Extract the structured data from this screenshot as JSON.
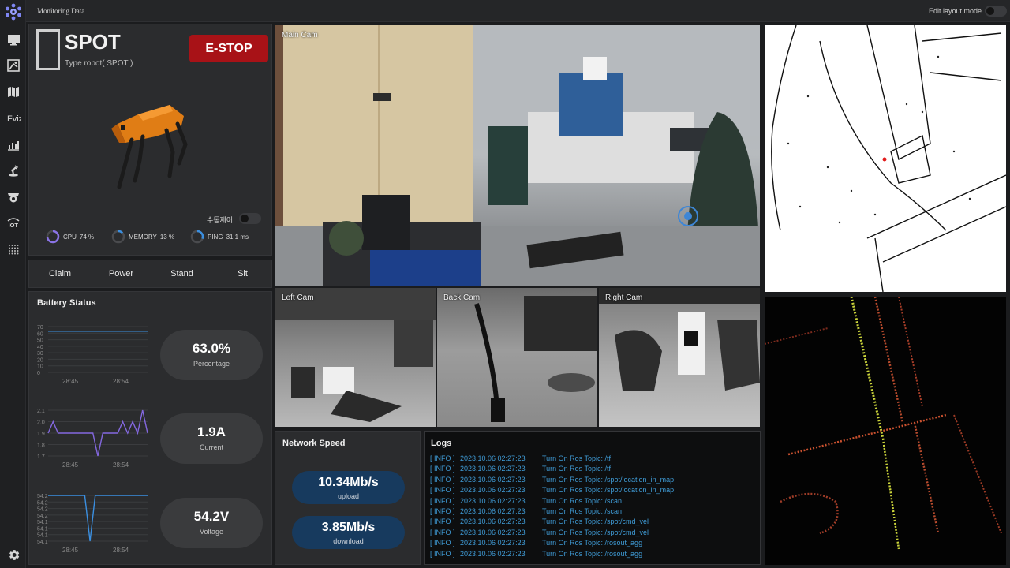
{
  "app": {
    "title": "Monitoring Data",
    "edit_layout_label": "Edit layout mode"
  },
  "sidebar": {
    "items": [
      {
        "icon": "monitor-icon"
      },
      {
        "icon": "map-edit-icon"
      },
      {
        "icon": "map-icon"
      },
      {
        "icon": "fviz-icon",
        "label": "Fviz"
      },
      {
        "icon": "chart-icon"
      },
      {
        "icon": "robot-arm-icon"
      },
      {
        "icon": "cctv-icon"
      },
      {
        "icon": "iot-icon",
        "label": "IOT"
      },
      {
        "icon": "grid-icon"
      }
    ],
    "settings_icon": "gear-icon"
  },
  "robot": {
    "name": "SPOT",
    "type": "Type robot( SPOT )",
    "estop_label": "E-STOP",
    "manual_label": "수동제어",
    "metrics": [
      {
        "label": "CPU",
        "value": "74 %",
        "fraction": 0.74
      },
      {
        "label": "MEMORY",
        "value": "13 %",
        "fraction": 0.13
      },
      {
        "label": "PING",
        "value": "31.1 ms",
        "fraction": 0.31
      }
    ]
  },
  "commands": [
    "Claim",
    "Power",
    "Stand",
    "Sit"
  ],
  "battery": {
    "title": "Battery Status",
    "percentage": {
      "value": "63.0%",
      "label": "Percentage"
    },
    "current": {
      "value": "1.9A",
      "label": "Current"
    },
    "voltage": {
      "value": "54.2V",
      "label": "Voltage"
    }
  },
  "chart_data": [
    {
      "type": "line",
      "x_ticks": [
        "28:45",
        "28:54"
      ],
      "y_ticks": [
        "70",
        "60",
        "50",
        "40",
        "30",
        "20",
        "10",
        "0"
      ],
      "ylim": [
        0,
        70
      ],
      "values": [
        63,
        63,
        63,
        63,
        63,
        63,
        63,
        63,
        63,
        63,
        63,
        63,
        63,
        63,
        63,
        63,
        63,
        63,
        63,
        63
      ],
      "color": "#3b8fe0"
    },
    {
      "type": "line",
      "x_ticks": [
        "28:45",
        "28:54"
      ],
      "y_ticks": [
        "2.1",
        "2.0",
        "1.9",
        "1.8",
        "1.7"
      ],
      "ylim": [
        1.7,
        2.1
      ],
      "values": [
        1.9,
        2.0,
        1.9,
        1.9,
        1.9,
        1.9,
        1.9,
        1.9,
        1.9,
        1.9,
        1.7,
        1.9,
        1.9,
        1.9,
        1.9,
        2.0,
        1.9,
        2.0,
        1.9,
        2.1,
        1.9
      ],
      "color": "#8468e0"
    },
    {
      "type": "line",
      "x_ticks": [
        "28:45",
        "28:54"
      ],
      "y_ticks": [
        "54.2",
        "54.2",
        "54.2",
        "54.2",
        "54.1",
        "54.1",
        "54.1",
        "54.1"
      ],
      "ylim": [
        54.1,
        54.2
      ],
      "values": [
        54.2,
        54.2,
        54.2,
        54.2,
        54.2,
        54.2,
        54.2,
        54.2,
        54.1,
        54.2,
        54.2,
        54.2,
        54.2,
        54.2,
        54.2,
        54.2,
        54.2,
        54.2,
        54.2,
        54.2
      ],
      "color": "#3b8fe0"
    }
  ],
  "cameras": {
    "main": "Main Cam",
    "left": "Left Cam",
    "back": "Back Cam",
    "right": "Right Cam"
  },
  "network": {
    "title": "Network Speed",
    "upload": {
      "value": "10.34Mb/s",
      "label": "upload"
    },
    "download": {
      "value": "3.85Mb/s",
      "label": "download"
    }
  },
  "logs": {
    "title": "Logs",
    "entries": [
      {
        "level": "[ INFO ]",
        "time": "2023.10.06  02:27:23",
        "message": "Turn On Ros Topic: /tf"
      },
      {
        "level": "[ INFO ]",
        "time": "2023.10.06  02:27:23",
        "message": "Turn On Ros Topic: /tf"
      },
      {
        "level": "[ INFO ]",
        "time": "2023.10.06  02:27:23",
        "message": "Turn On Ros Topic: /spot/location_in_map"
      },
      {
        "level": "[ INFO ]",
        "time": "2023.10.06  02:27:23",
        "message": "Turn On Ros Topic: /spot/location_in_map"
      },
      {
        "level": "[ INFO ]",
        "time": "2023.10.06  02:27:23",
        "message": "Turn On Ros Topic: /scan"
      },
      {
        "level": "[ INFO ]",
        "time": "2023.10.06  02:27:23",
        "message": "Turn On Ros Topic: /scan"
      },
      {
        "level": "[ INFO ]",
        "time": "2023.10.06  02:27:23",
        "message": "Turn On Ros Topic: /spot/cmd_vel"
      },
      {
        "level": "[ INFO ]",
        "time": "2023.10.06  02:27:23",
        "message": "Turn On Ros Topic: /spot/cmd_vel"
      },
      {
        "level": "[ INFO ]",
        "time": "2023.10.06  02:27:23",
        "message": "Turn On Ros Topic: /rosout_agg"
      },
      {
        "level": "[ INFO ]",
        "time": "2023.10.06  02:27:23",
        "message": "Turn On Ros Topic: /rosout_agg"
      }
    ]
  },
  "colors": {
    "estop": "#a81217",
    "accent": "#3b8fe0",
    "current_line": "#8468e0",
    "pill": "#173a5e"
  }
}
